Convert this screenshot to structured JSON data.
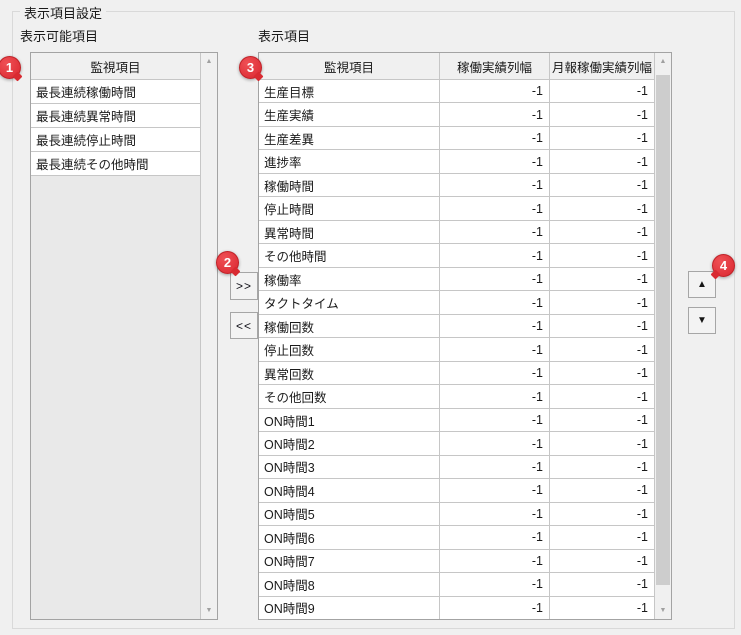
{
  "group": {
    "title": "表示項目設定"
  },
  "available": {
    "label": "表示可能項目",
    "header": "監視項目",
    "items": [
      "最長連続稼働時間",
      "最長連続異常時間",
      "最長連続停止時間",
      "最長連続その他時間"
    ]
  },
  "selected": {
    "label": "表示項目",
    "columns": [
      "監視項目",
      "稼働実績列幅",
      "月報稼働実績列幅"
    ],
    "rows": [
      {
        "name": "生産目標",
        "kadou_width": "-1",
        "geppou_width": "-1"
      },
      {
        "name": "生産実績",
        "kadou_width": "-1",
        "geppou_width": "-1"
      },
      {
        "name": "生産差異",
        "kadou_width": "-1",
        "geppou_width": "-1"
      },
      {
        "name": "進捗率",
        "kadou_width": "-1",
        "geppou_width": "-1"
      },
      {
        "name": "稼働時間",
        "kadou_width": "-1",
        "geppou_width": "-1"
      },
      {
        "name": "停止時間",
        "kadou_width": "-1",
        "geppou_width": "-1"
      },
      {
        "name": "異常時間",
        "kadou_width": "-1",
        "geppou_width": "-1"
      },
      {
        "name": "その他時間",
        "kadou_width": "-1",
        "geppou_width": "-1"
      },
      {
        "name": "稼働率",
        "kadou_width": "-1",
        "geppou_width": "-1"
      },
      {
        "name": "タクトタイム",
        "kadou_width": "-1",
        "geppou_width": "-1"
      },
      {
        "name": "稼働回数",
        "kadou_width": "-1",
        "geppou_width": "-1"
      },
      {
        "name": "停止回数",
        "kadou_width": "-1",
        "geppou_width": "-1"
      },
      {
        "name": "異常回数",
        "kadou_width": "-1",
        "geppou_width": "-1"
      },
      {
        "name": "その他回数",
        "kadou_width": "-1",
        "geppou_width": "-1"
      },
      {
        "name": "ON時間1",
        "kadou_width": "-1",
        "geppou_width": "-1"
      },
      {
        "name": "ON時間2",
        "kadou_width": "-1",
        "geppou_width": "-1"
      },
      {
        "name": "ON時間3",
        "kadou_width": "-1",
        "geppou_width": "-1"
      },
      {
        "name": "ON時間4",
        "kadou_width": "-1",
        "geppou_width": "-1"
      },
      {
        "name": "ON時間5",
        "kadou_width": "-1",
        "geppou_width": "-1"
      },
      {
        "name": "ON時間6",
        "kadou_width": "-1",
        "geppou_width": "-1"
      },
      {
        "name": "ON時間7",
        "kadou_width": "-1",
        "geppou_width": "-1"
      },
      {
        "name": "ON時間8",
        "kadou_width": "-1",
        "geppou_width": "-1"
      },
      {
        "name": "ON時間9",
        "kadou_width": "-1",
        "geppou_width": "-1"
      }
    ]
  },
  "buttons": {
    "move_right": ">>",
    "move_left": "<<",
    "move_up_icon": "▲",
    "move_down_icon": "▼"
  },
  "icons": {
    "scroll_up": "▲",
    "scroll_down": "▼"
  },
  "badges": {
    "b1": "1",
    "b2": "2",
    "b3": "3",
    "b4": "4"
  },
  "colors": {
    "badge_red": "#da2730",
    "panel_bg": "#f0f0f0",
    "cell_bg": "#ffffff",
    "grid_line": "#c6c6c6",
    "table_border": "#a3a3a3"
  }
}
